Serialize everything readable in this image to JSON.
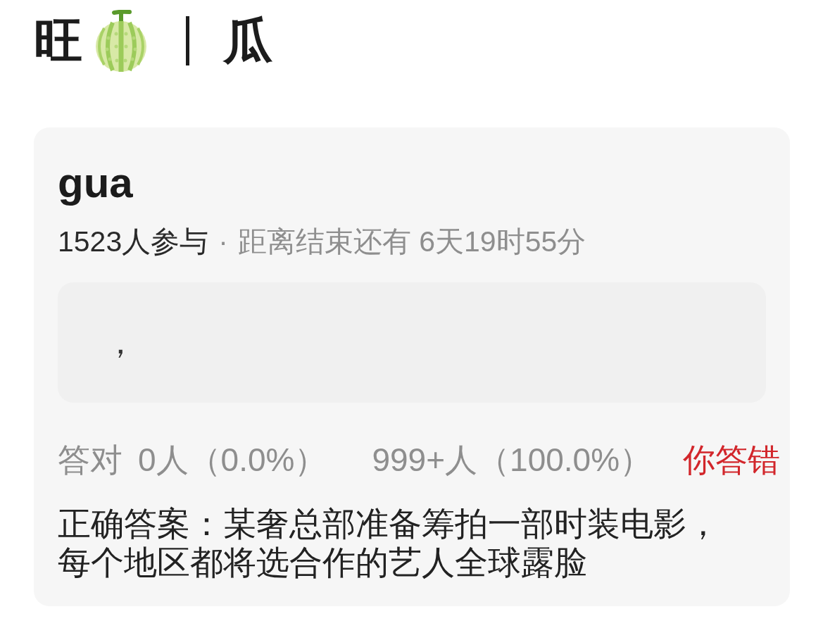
{
  "header": {
    "title_start": "旺",
    "title_end": "瓜"
  },
  "quiz": {
    "title": "gua",
    "participants": "1523人参与",
    "separator": "·",
    "countdown": "距离结束还有 6天19时55分",
    "options": [
      {
        "text": "，"
      }
    ],
    "stats": {
      "label": "答对",
      "correct_count": "0人（0.0%）",
      "wrong_count": "999+人（100.0%）"
    },
    "verdict": {
      "text": "你答错",
      "correct": false
    },
    "answer": "正确答案：某奢总部准备筹拍一部时装电影，每个地区都将选合作的艺人全球露脸"
  }
}
